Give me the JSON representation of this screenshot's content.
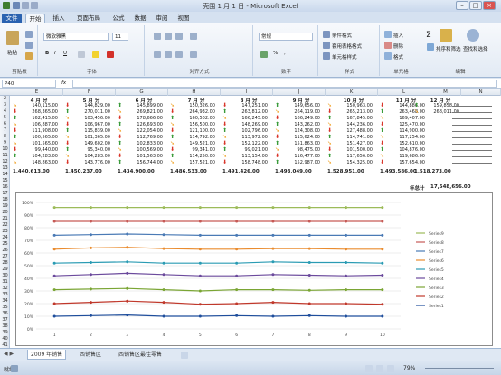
{
  "window": {
    "title": "壳围 1 月 1 日 - Microsoft Excel"
  },
  "tabs": [
    "文件",
    "开始",
    "插入",
    "页面布局",
    "公式",
    "数据",
    "审阅",
    "视图"
  ],
  "ribbon": {
    "paste_label": "粘贴",
    "font_name": "微软雅黑",
    "font_size": "11",
    "number_format": "常规",
    "cond_format": "条件格式",
    "table_format": "套用表格格式",
    "cell_styles": "单元格样式",
    "insert": "插入",
    "delete": "删除",
    "format": "格式",
    "sort_filter": "排序和筛选",
    "find_select": "查找和选择",
    "group_labels": [
      "剪贴板",
      "字体",
      "对齐方式",
      "数字",
      "样式",
      "单元格",
      "编辑"
    ]
  },
  "formula_bar": {
    "name_box": "P40",
    "fx": "fx",
    "formula": ""
  },
  "columns": [
    "E",
    "F",
    "G",
    "H",
    "I",
    "J",
    "K",
    "L",
    "M",
    "N"
  ],
  "rows": [
    "2",
    "3",
    "4",
    "5",
    "6",
    "7",
    "8",
    "9",
    "10",
    "11",
    "12",
    "13",
    "14",
    "15",
    "16",
    "17",
    "18",
    "19",
    "20",
    "21",
    "22",
    "23",
    "24",
    "25",
    "26",
    "27",
    "28",
    "29",
    "30",
    "31",
    "32",
    "33",
    "34",
    "35",
    "36",
    "37",
    "38",
    "39",
    "40",
    "41"
  ],
  "months": [
    "4 月 分",
    "5 月 分",
    "6 月 分",
    "7 月 分",
    "8 月 分",
    "9 月 分",
    "10 月 分",
    "11 月 分",
    "12 月 分"
  ],
  "table_rows": [
    [
      "140,115.00",
      "144,829.00",
      "145,899.00",
      "150,326.00",
      "147,251.00",
      "149,656.00",
      "150,963.00",
      "144,886.00",
      "159,858.00"
    ],
    [
      "268,365.00",
      "270,011.00",
      "269,821.00",
      "264,932.00",
      "263,812.00",
      "264,119.00",
      "265,213.00",
      "263,468.00",
      "268,011.00"
    ],
    [
      "162,415.00",
      "103,456.00",
      "178,666.00",
      "160,502.00",
      "166,245.00",
      "166,249.00",
      "167,845.00",
      "169,407.00"
    ],
    [
      "106,887.00",
      "106,967.00",
      "126,693.00",
      "156,500.00",
      "148,269.00",
      "143,262.00",
      "144,236.00",
      "125,470.00"
    ],
    [
      "111,908.00",
      "115,839.00",
      "122,054.00",
      "121,100.00",
      "102,796.00",
      "124,308.00",
      "127,488.00",
      "114,900.00"
    ],
    [
      "100,565.00",
      "101,365.00",
      "112,769.00",
      "114,792.00",
      "113,972.00",
      "115,624.00",
      "114,741.00",
      "117,254.00"
    ],
    [
      "101,565.00",
      "149,602.00",
      "102,833.00",
      "149,521.00",
      "152,122.00",
      "151,863.00",
      "151,427.00",
      "152,610.00"
    ],
    [
      "99,440.00",
      "95,340.00",
      "100,569.00",
      "99,341.00",
      "99,021.00",
      "98,475.00",
      "101,500.00",
      "104,876.00"
    ],
    [
      "104,283.00",
      "104,283.00",
      "101,563.00",
      "114,250.00",
      "113,154.00",
      "116,477.00",
      "117,656.00",
      "119,686.00"
    ],
    [
      "148,863.00",
      "143,776.00",
      "156,744.00",
      "157,521.00",
      "158,748.00",
      "152,987.00",
      "154,325.00",
      "157,654.00"
    ]
  ],
  "totals": [
    "1,440,613.00",
    "1,450,237.00",
    "1,434,900.00",
    "1,486,533.00",
    "1,491,426.00",
    "1,493,049.00",
    "1,528,951.00",
    "1,493,586.00",
    "1,518,273.00"
  ],
  "year_total_label": "年总计",
  "year_total_value": "17,548,656.00",
  "chart_data": {
    "type": "line",
    "categories": [
      "1",
      "2",
      "3",
      "4",
      "5",
      "6",
      "7",
      "8",
      "9",
      "10"
    ],
    "ylim": [
      0,
      100
    ],
    "yticks": [
      "0%",
      "10%",
      "20%",
      "30%",
      "40%",
      "50%",
      "60%",
      "70%",
      "80%",
      "90%",
      "100%"
    ],
    "series": [
      {
        "name": "Series1",
        "color": "#1f4e9c",
        "values": [
          10,
          10.5,
          11,
          10,
          10,
          10.5,
          10,
          10.5,
          10,
          10
        ]
      },
      {
        "name": "Series2",
        "color": "#c0382b",
        "values": [
          20,
          21,
          22,
          21,
          19.5,
          20,
          21,
          20,
          20,
          19.5
        ]
      },
      {
        "name": "Series3",
        "color": "#7aa534",
        "values": [
          31,
          31.5,
          32,
          31,
          30,
          31,
          31,
          30.5,
          31,
          31
        ]
      },
      {
        "name": "Series4",
        "color": "#6b4a9c",
        "values": [
          42,
          43,
          44,
          43,
          42,
          42,
          43,
          42.5,
          42,
          42.5
        ]
      },
      {
        "name": "Series5",
        "color": "#2a9bb3",
        "values": [
          52,
          52.5,
          53,
          52,
          52,
          52,
          53,
          52.5,
          52.5,
          52
        ]
      },
      {
        "name": "Series6",
        "color": "#ea8c2f",
        "values": [
          63,
          64,
          64.5,
          63.5,
          63,
          63,
          63.5,
          63.5,
          63,
          63
        ]
      },
      {
        "name": "Series7",
        "color": "#4a7ab5",
        "values": [
          74,
          74.5,
          75,
          74.5,
          74,
          74,
          74,
          74,
          74,
          74
        ]
      },
      {
        "name": "Series8",
        "color": "#c65a56",
        "values": [
          85,
          85,
          85,
          85,
          85,
          85,
          85,
          85,
          85,
          85
        ]
      },
      {
        "name": "Series9",
        "color": "#9cbb59",
        "values": [
          96,
          96,
          96,
          96,
          96,
          96,
          96,
          96,
          96,
          96
        ]
      }
    ],
    "legend": "right"
  },
  "sheet_tabs": [
    "2009 年销售",
    "西销售区",
    "西销售区最佳零售"
  ],
  "status": {
    "ready": "就绪",
    "zoom": "79%"
  }
}
